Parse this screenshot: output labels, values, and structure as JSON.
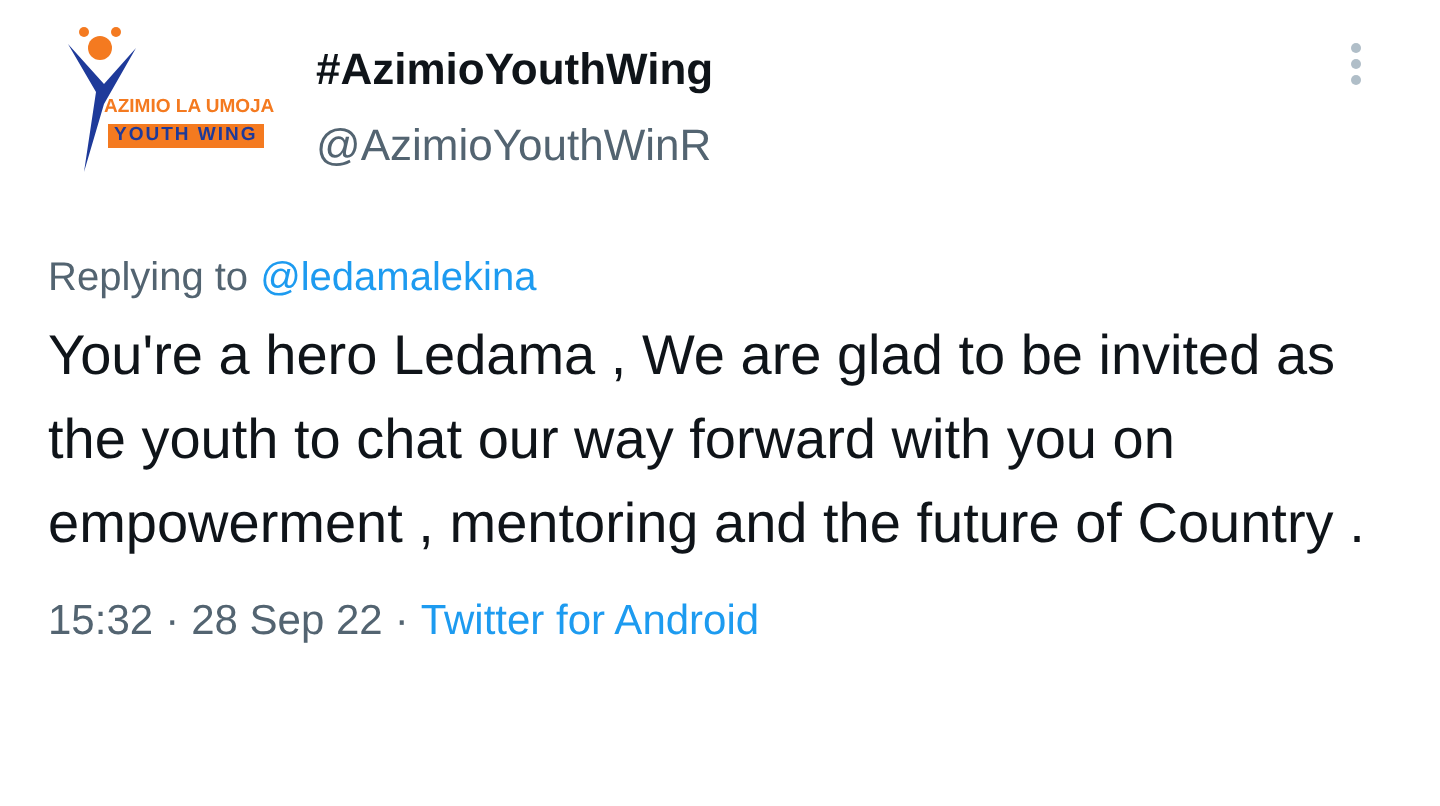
{
  "author": {
    "logo_lines": [
      "AZIMIO LA UMOJA",
      "YOUTH WING"
    ],
    "name": "#AzimioYouthWing",
    "handle": "@AzimioYouthWinR"
  },
  "reply": {
    "prefix": "Replying to",
    "mention": "@ledamalekina"
  },
  "text": "You're a hero Ledama , We are glad to be invited as the youth to chat our way forward with you on empowerment , mentoring and the future of Country .",
  "meta": {
    "time": "15:32",
    "separator": "·",
    "date": "28 Sep 22",
    "separator_2": "·",
    "source": "Twitter for Android"
  }
}
